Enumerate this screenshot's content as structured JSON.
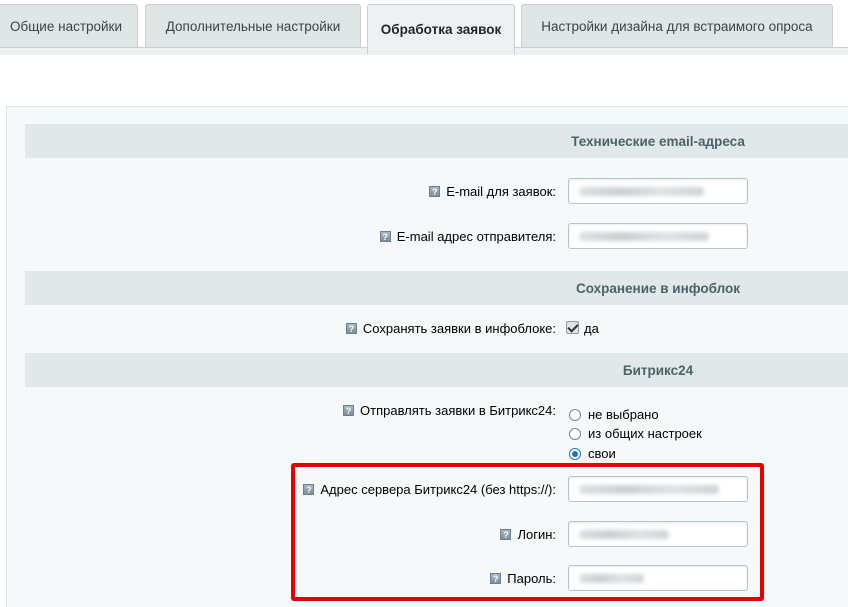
{
  "tabs": [
    {
      "label": "Общие настройки"
    },
    {
      "label": "Дополнительные настройки"
    },
    {
      "label": "Обработка заявок",
      "active": true
    },
    {
      "label": "Настройки дизайна для встраимого опроса"
    }
  ],
  "sections": {
    "tech_emails": "Технические email-адреса",
    "infoblock": "Сохранение в инфоблок",
    "bitrix24": "Битрикс24"
  },
  "fields": {
    "email_requests_label": "E-mail для заявок:",
    "email_sender_label": "E-mail адрес отправителя:",
    "save_infoblock_label": "Сохранять заявки в инфоблоке:",
    "save_infoblock_value": "да",
    "send_bitrix_label": "Отправлять заявки в Битрикс24:",
    "server_label": "Адрес сервера Битрикс24 (без https://):",
    "login_label": "Логин:",
    "password_label": "Пароль:"
  },
  "radio_options": [
    {
      "label": "не выбрано",
      "checked": false
    },
    {
      "label": "из общих настроек",
      "checked": false
    },
    {
      "label": "свои",
      "checked": true
    }
  ],
  "help_glyph": "?",
  "colors": {
    "highlight": "#e60000",
    "section_bg": "#e0e8ea",
    "radio_accent": "#1a73c7"
  }
}
